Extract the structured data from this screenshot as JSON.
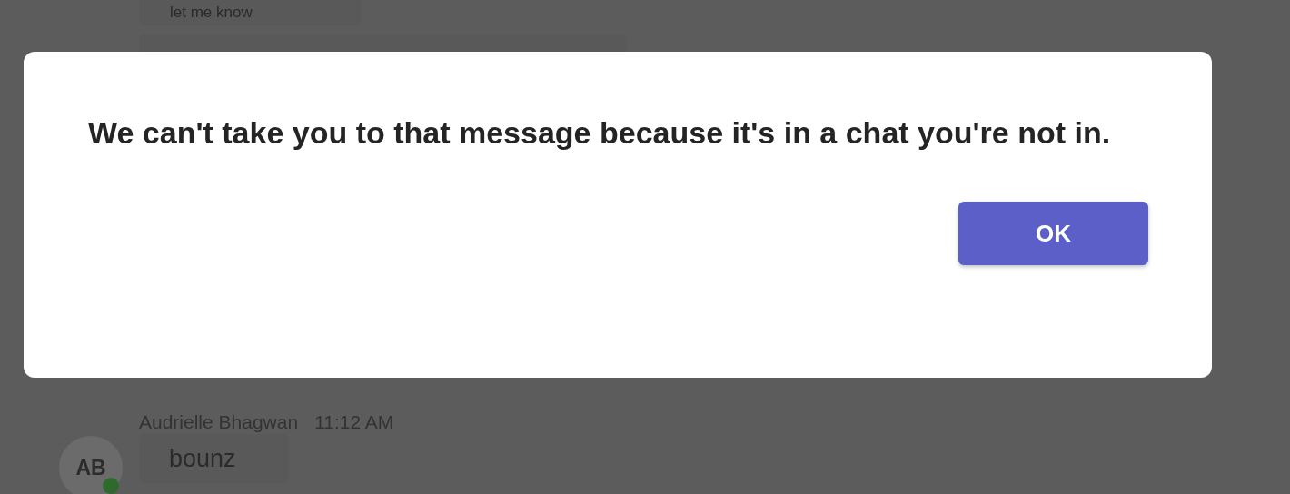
{
  "chat": {
    "messages": [
      {
        "text": "let me know"
      },
      {
        "author": "Audrielle Bhagwan",
        "time": "11:12 AM",
        "initials": "AB",
        "online": true,
        "text": "bounz"
      }
    ]
  },
  "dialog": {
    "message": "We can't take you to that message because it's in a chat you're not in.",
    "button": "OK"
  }
}
